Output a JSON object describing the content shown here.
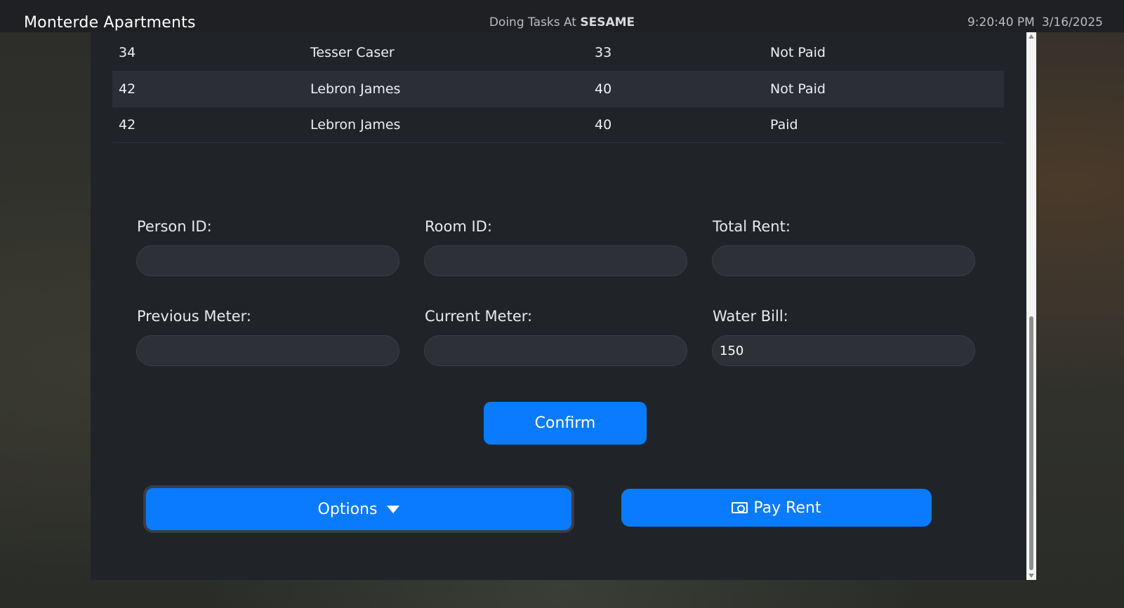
{
  "header": {
    "app_title": "Monterde Apartments",
    "tasks_prefix": "Doing Tasks At",
    "tasks_location": "SESAME",
    "time": "9:20:40 PM",
    "date": "3/16/2025"
  },
  "table": {
    "rows": [
      {
        "room_id": "34",
        "name": "Tesser Caser",
        "person_id": "33",
        "status": "Not Paid"
      },
      {
        "room_id": "42",
        "name": "Lebron James",
        "person_id": "40",
        "status": "Not Paid"
      },
      {
        "room_id": "42",
        "name": "Lebron James",
        "person_id": "40",
        "status": "Paid"
      }
    ]
  },
  "form": {
    "person_id": {
      "label": "Person ID:",
      "value": ""
    },
    "room_id": {
      "label": "Room ID:",
      "value": ""
    },
    "total_rent": {
      "label": "Total Rent:",
      "value": ""
    },
    "previous_meter": {
      "label": "Previous Meter:",
      "value": ""
    },
    "current_meter": {
      "label": "Current Meter:",
      "value": ""
    },
    "water_bill": {
      "label": "Water Bill:",
      "value": "150"
    },
    "confirm_label": "Confirm"
  },
  "actions": {
    "options_label": "Options",
    "pay_rent_label": "Pay Rent"
  },
  "icons": {
    "options_caret": "caret-down-icon",
    "pay_rent": "money-bill-icon"
  },
  "colors": {
    "accent": "#0a7bff",
    "panel": "#202328",
    "header": "#1e2023"
  }
}
